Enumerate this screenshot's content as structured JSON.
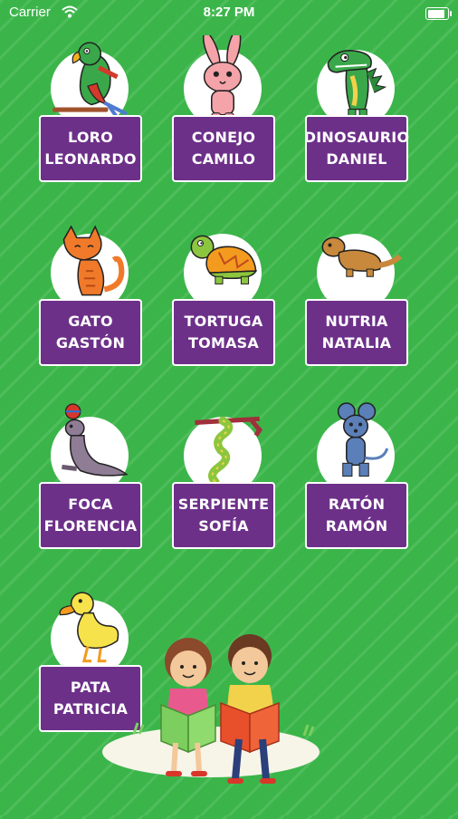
{
  "status_bar": {
    "carrier": "Carrier",
    "time": "8:27 PM",
    "battery_level": 0.85
  },
  "theme": {
    "background": "#3bb54a",
    "card_color": "#6d3089",
    "card_text": "#ffffff"
  },
  "animals": [
    {
      "line1": "LORO",
      "line2": "LEONARDO",
      "icon": "parrot-icon"
    },
    {
      "line1": "CONEJO",
      "line2": "CAMILO",
      "icon": "rabbit-icon"
    },
    {
      "line1": "DINOSAURIO",
      "line2": "DANIEL",
      "icon": "dinosaur-icon"
    },
    {
      "line1": "GATO",
      "line2": "GASTÓN",
      "icon": "cat-icon"
    },
    {
      "line1": "TORTUGA",
      "line2": "TOMASA",
      "icon": "turtle-icon"
    },
    {
      "line1": "NUTRIA",
      "line2": "NATALIA",
      "icon": "otter-icon"
    },
    {
      "line1": "FOCA",
      "line2": "FLORENCIA",
      "icon": "seal-icon"
    },
    {
      "line1": "SERPIENTE",
      "line2": "SOFÍA",
      "icon": "snake-icon"
    },
    {
      "line1": "RATÓN",
      "line2": "RAMÓN",
      "icon": "mouse-icon"
    },
    {
      "line1": "PATA",
      "line2": "PATRICIA",
      "icon": "duck-icon"
    }
  ],
  "illustration": {
    "icon": "children-reading-icon"
  }
}
